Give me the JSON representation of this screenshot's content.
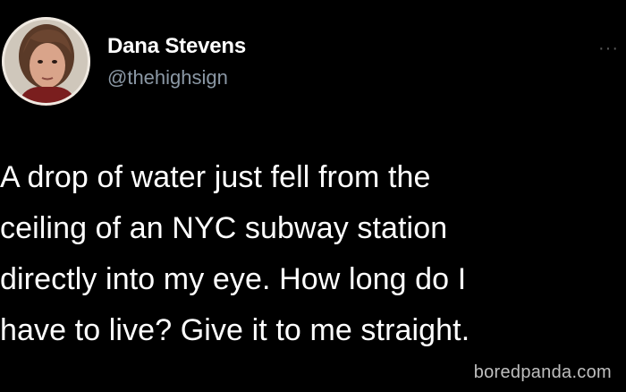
{
  "tweet": {
    "author": {
      "display_name": "Dana Stevens",
      "handle": "@thehighsign",
      "avatar_icon": "user-avatar"
    },
    "more_icon": "more-options-icon",
    "more_label": "···",
    "text": "A drop of water just fell from the\nceiling of an NYC subway station\ndirectly into my eye. How long do I\nhave to live? Give it to me straight."
  },
  "watermark": "boredpanda.com",
  "colors": {
    "background": "#000000",
    "text": "#ffffff",
    "handle": "#8b98a5"
  }
}
